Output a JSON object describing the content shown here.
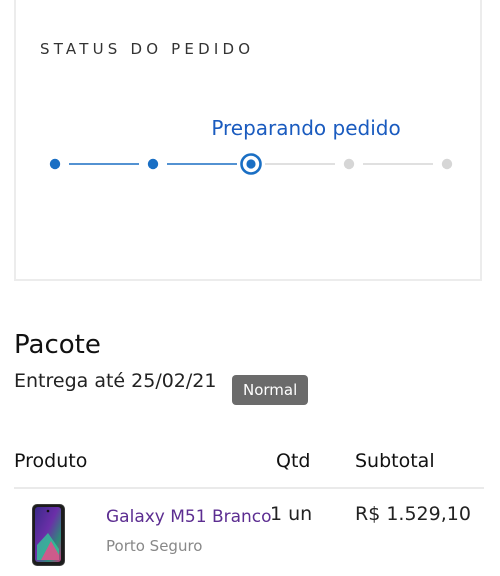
{
  "status": {
    "title": "STATUS DO PEDIDO",
    "current_stage": "Preparando pedido",
    "total_steps": 5,
    "current_step": 3,
    "colors": {
      "accent": "#1a5bbf",
      "done": "#1a6fc4",
      "pending": "#d6d6d6"
    }
  },
  "package": {
    "title": "Pacote",
    "delivery": "Entrega até 25/02/21",
    "shipping_badge": "Normal"
  },
  "table": {
    "headers": {
      "product": "Produto",
      "qty": "Qtd",
      "subtotal": "Subtotal"
    },
    "items": [
      {
        "name": "Galaxy M51 Branco",
        "seller": "Porto Seguro",
        "qty": "1 un",
        "subtotal": "R$ 1.529,10",
        "image_icon": "phone-thumbnail-icon"
      }
    ]
  }
}
